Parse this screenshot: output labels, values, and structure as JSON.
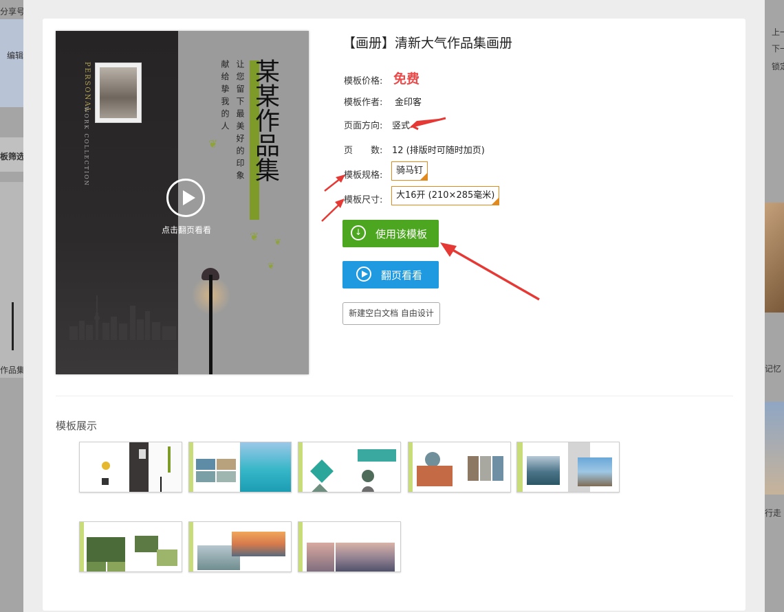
{
  "background": {
    "left_texts": [
      "分享号",
      "编辑",
      "板筛选",
      "作品集"
    ],
    "right_texts": [
      "上一",
      "下一",
      "锁定",
      "记忆",
      "行走"
    ]
  },
  "cover": {
    "title": "某某作品集",
    "poem_lines": [
      "让您留下最美好的印象",
      "献给挚我的人"
    ],
    "english_1": "PERSONAL",
    "english_2": "WORK COLLECTION",
    "play_label": "点击翻页看看"
  },
  "template": {
    "title": "【画册】清新大气作品集画册",
    "price_label": "模板价格:",
    "price_value": "免费",
    "author_label": "模板作者:",
    "author_value": "金印客",
    "orientation_label": "页面方向:",
    "orientation_value": "竖式",
    "pages_label": "页　　数:",
    "pages_value": "12 (排版时可随时加页)",
    "spec_label": "模板规格:",
    "spec_value": "骑马钉",
    "size_label": "模板尺寸:",
    "size_value": "大16开 (210×285毫米)"
  },
  "buttons": {
    "use_template": "使用该模板",
    "flip_view": "翻页看看",
    "new_blank": "新建空白文档 自由设计"
  },
  "gallery": {
    "title": "模板展示"
  },
  "colors": {
    "accent_green": "#4ca61f",
    "accent_blue": "#1f9ae0",
    "price_red": "#e94b4b",
    "tag_orange": "#e08a1e",
    "arrow_red": "#e53935"
  }
}
